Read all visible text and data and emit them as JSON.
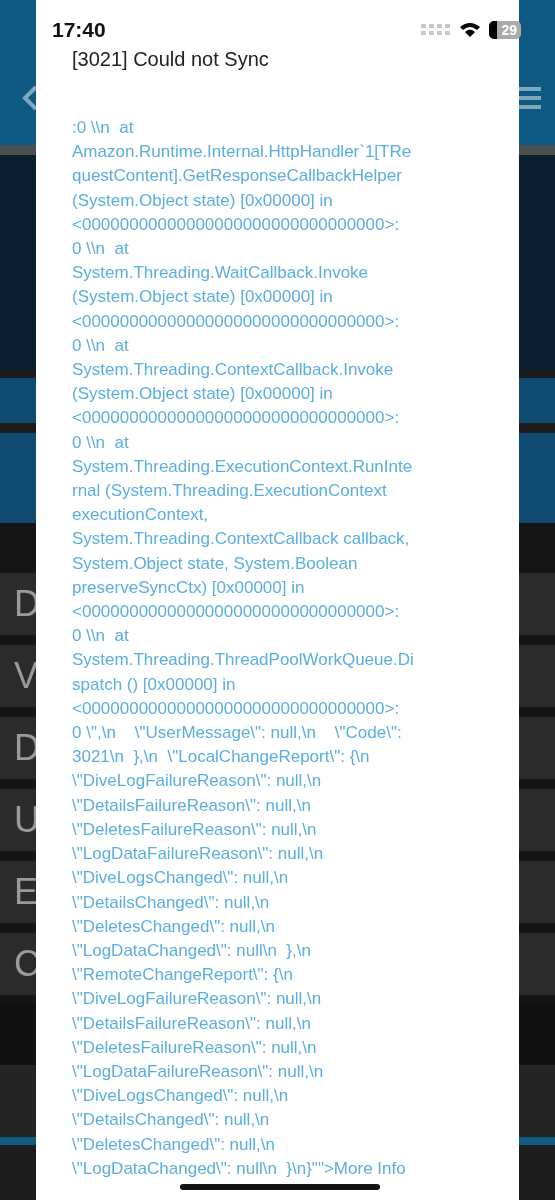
{
  "status_bar": {
    "time": "17:40",
    "battery": "29"
  },
  "background": {
    "rows": [
      {
        "label": "D"
      },
      {
        "label": "V"
      },
      {
        "label": "D"
      },
      {
        "label": "U"
      },
      {
        "label": "E"
      },
      {
        "label": "C"
      }
    ]
  },
  "dialog": {
    "title": "[3021] Could not Sync",
    "message_lines": [
      ":0 \\\\n  at",
      "Amazon.Runtime.Internal.HttpHandler`1[TRe",
      "questContent].GetResponseCallbackHelper",
      "(System.Object state) [0x00000] in",
      "<00000000000000000000000000000000>:",
      "0 \\\\n  at",
      "System.Threading.WaitCallback.Invoke",
      "(System.Object state) [0x00000] in",
      "<00000000000000000000000000000000>:",
      "0 \\\\n  at",
      "System.Threading.ContextCallback.Invoke",
      "(System.Object state) [0x00000] in",
      "<00000000000000000000000000000000>:",
      "0 \\\\n  at",
      "System.Threading.ExecutionContext.RunInte",
      "rnal (System.Threading.ExecutionContext",
      "executionContext,",
      "System.Threading.ContextCallback callback,",
      "System.Object state, System.Boolean",
      "preserveSyncCtx) [0x00000] in",
      "<00000000000000000000000000000000>:",
      "0 \\\\n  at",
      "System.Threading.ThreadPoolWorkQueue.Di",
      "spatch () [0x00000] in",
      "<00000000000000000000000000000000>:",
      "0 \\\",\\n    \\\"UserMessage\\\": null,\\n    \\\"Code\\\":",
      "3021\\n  },\\n  \\\"LocalChangeReport\\\": {\\n",
      "\\\"DiveLogFailureReason\\\": null,\\n",
      "\\\"DetailsFailureReason\\\": null,\\n",
      "\\\"DeletesFailureReason\\\": null,\\n",
      "\\\"LogDataFailureReason\\\": null,\\n",
      "\\\"DiveLogsChanged\\\": null,\\n",
      "\\\"DetailsChanged\\\": null,\\n",
      "\\\"DeletesChanged\\\": null,\\n",
      "\\\"LogDataChanged\\\": null\\n  },\\n",
      "\\\"RemoteChangeReport\\\": {\\n",
      "\\\"DiveLogFailureReason\\\": null,\\n",
      "\\\"DetailsFailureReason\\\": null,\\n",
      "\\\"DeletesFailureReason\\\": null,\\n",
      "\\\"LogDataFailureReason\\\": null,\\n",
      "\\\"DiveLogsChanged\\\": null,\\n",
      "\\\"DetailsChanged\\\": null,\\n",
      "\\\"DeletesChanged\\\": null,\\n",
      "\\\"LogDataChanged\\\": null\\n  }\\n}\"\">More Info"
    ]
  }
}
